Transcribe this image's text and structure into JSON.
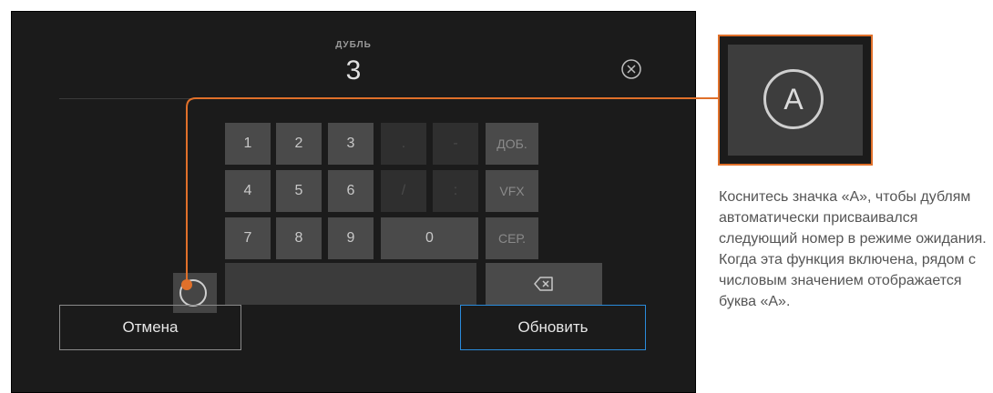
{
  "dialog": {
    "field_label": "ДУБЛЬ",
    "field_value": "3",
    "cancel_label": "Отмена",
    "update_label": "Обновить"
  },
  "keypad": {
    "row1": [
      "1",
      "2",
      "3",
      ".",
      "-",
      "ДОБ."
    ],
    "row2": [
      "4",
      "5",
      "6",
      "/",
      ":",
      "VFX"
    ],
    "row3": [
      "7",
      "8",
      "9",
      "0",
      "СЕР."
    ]
  },
  "callout": {
    "zoom_letter": "A",
    "description": "Коснитесь значка «A», чтобы дублям автоматически присваивался следующий номер в режиме ожидания. Когда эта функция включена, рядом с числовым значением отображается буква «A»."
  },
  "colors": {
    "accent_orange": "#e0702a",
    "update_border_blue": "#2a8bdb",
    "screen_bg": "#1b1b1b"
  },
  "icons": {
    "clear": "circle-x-icon",
    "auto": "circle-dot-icon",
    "backspace": "backspace-icon"
  }
}
